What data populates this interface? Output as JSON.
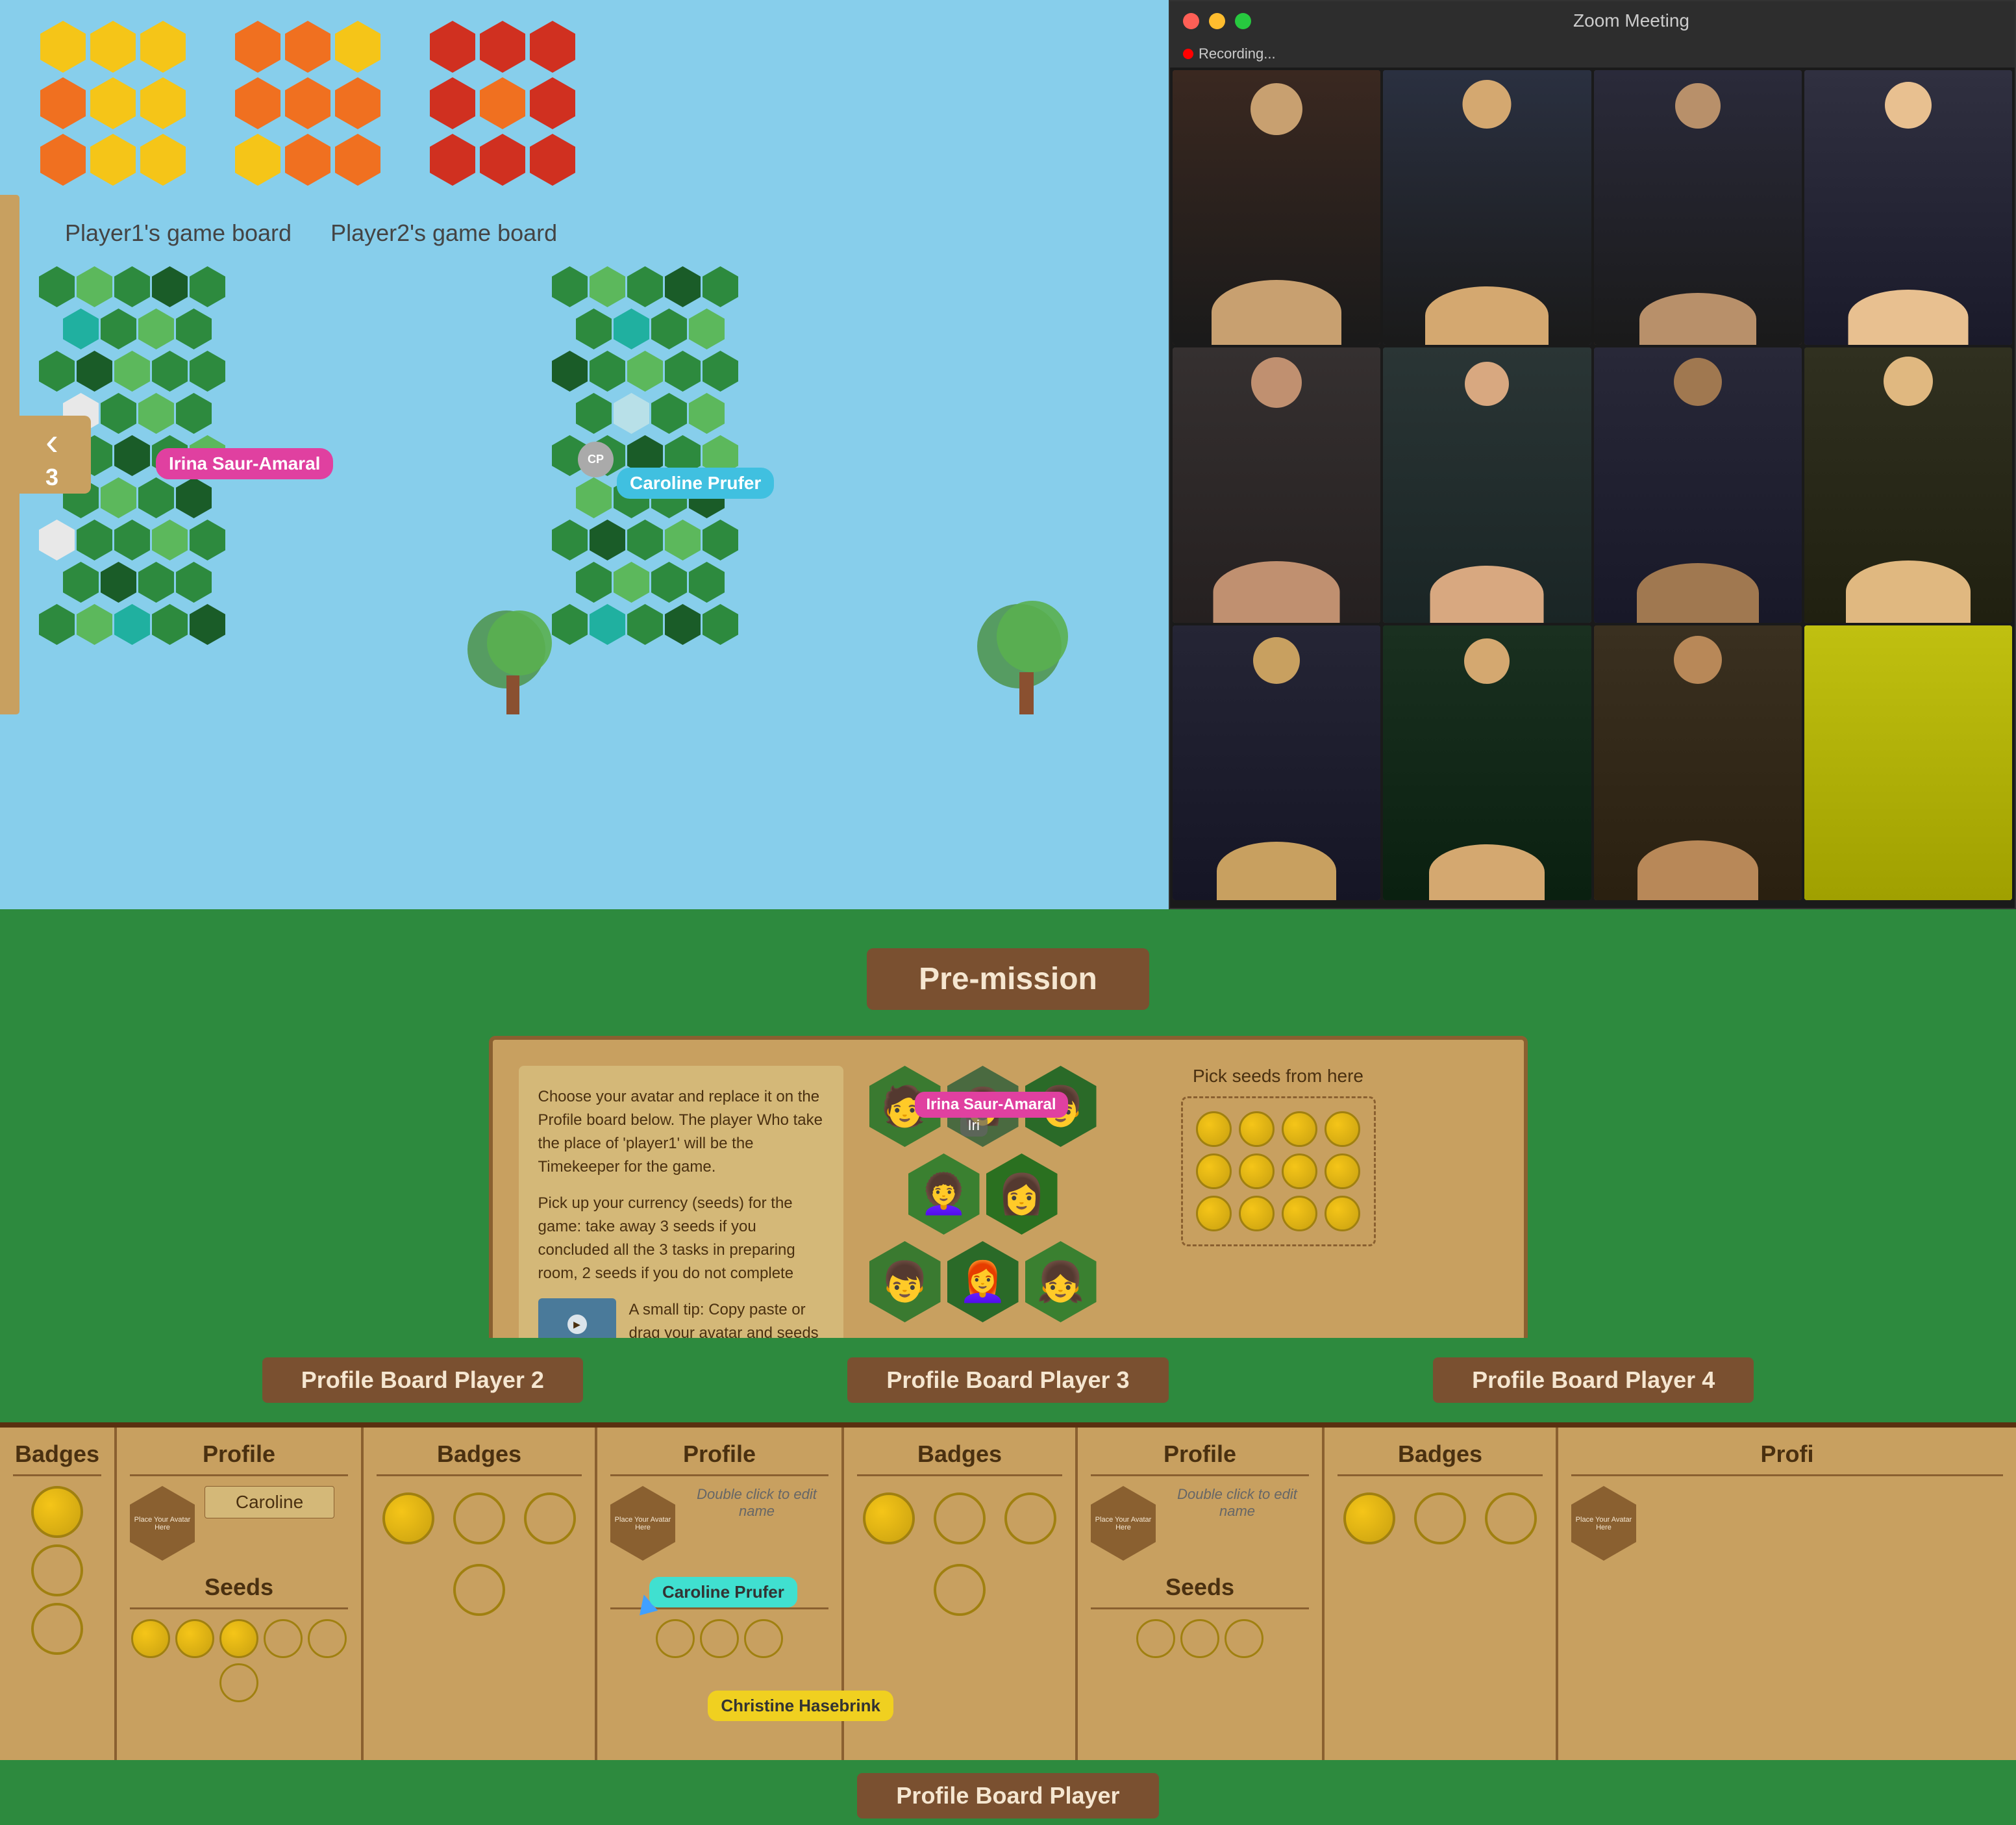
{
  "window": {
    "title": "Zoom Meeting",
    "recording_label": "Recording..."
  },
  "game": {
    "nav_number": "3",
    "nav_arrow": "‹",
    "player1_board_label": "Player1's game board",
    "player2_board_label": "Player2's game board",
    "player1_name": "Irina Saur-Amaral",
    "player2_name": "Caroline Prufer",
    "pre_mission_title": "Pre-mission",
    "mission_text_1": "Choose your avatar and replace it on the Profile board below. The player Who take the place of 'player1' will be the Timekeeper for the game.",
    "mission_text_2": "Pick up your currency (seeds) for the game: take away 3 seeds if you concluded all the 3 tasks in preparing room, 2 seeds  if you do not complete",
    "video_tip_text": "A small tip: Copy paste or drag your avatar and seeds",
    "seeds_from_here_label": "Pick seeds from here"
  },
  "profile_boards": {
    "board2_label": "Profile Board Player 2",
    "board3_label": "Profile Board Player 3",
    "board4_label": "Profile Board Player 4",
    "board1_label": "Profile Board Player",
    "badges_label": "Badges",
    "profile_label": "Profile",
    "seeds_label": "Seeds",
    "player2_name": "Caroline",
    "double_click_hint": "Double click to edit name",
    "caroline_cursor": "Caroline Prufer",
    "christine_cursor": "Christine Hasebrink"
  },
  "zoom_dots": {
    "red": "#ff5f56",
    "yellow": "#ffbd2e",
    "green": "#27c93f"
  }
}
